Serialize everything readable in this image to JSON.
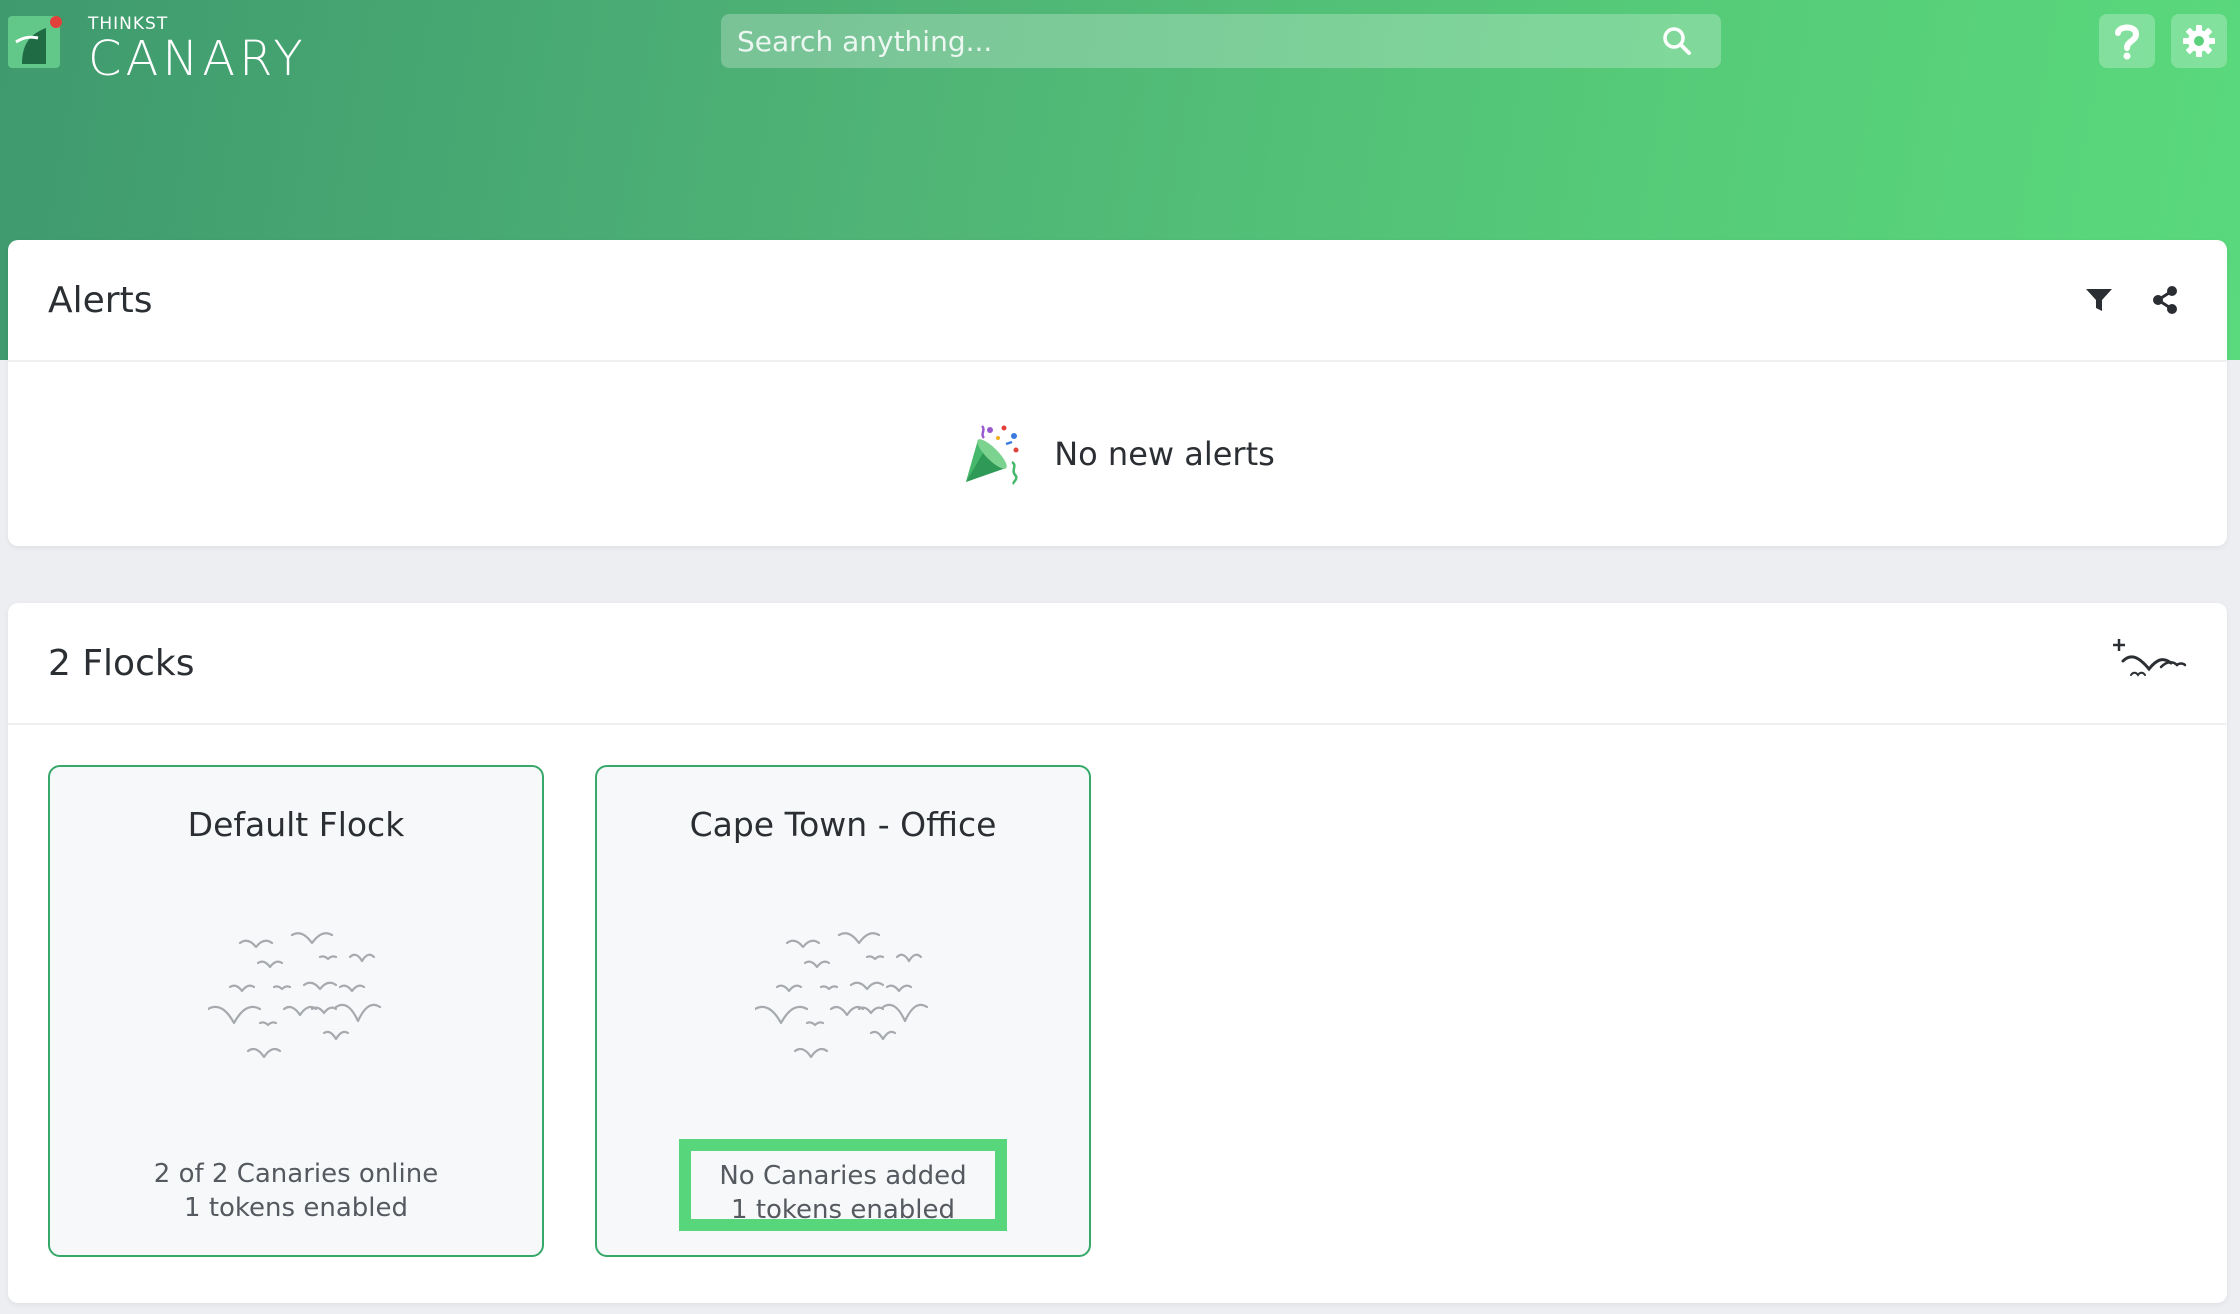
{
  "brand": {
    "small": "THINKST",
    "name": "CANARY",
    "accent": "#4fb476"
  },
  "search": {
    "placeholder": "Search anything..."
  },
  "toolbar": {
    "help_icon": "question-mark-icon",
    "settings_icon": "gear-icon"
  },
  "alerts": {
    "title": "Alerts",
    "actions": [
      "filter-icon",
      "share-icon"
    ],
    "empty_message": "No new alerts",
    "empty_icon": "party-popper-icon"
  },
  "flocks": {
    "title": "2 Flocks",
    "add_icon": "add-flock-icon",
    "items": [
      {
        "name": "Default Flock",
        "line1": "2 of 2 Canaries online",
        "line2": "1 tokens enabled",
        "icon": "birds-icon"
      },
      {
        "name": "Cape Town - Office",
        "line1": "No Canaries added",
        "line2": "1 tokens enabled",
        "icon": "birds-icon",
        "highlight_color": "#58d67c"
      }
    ]
  }
}
